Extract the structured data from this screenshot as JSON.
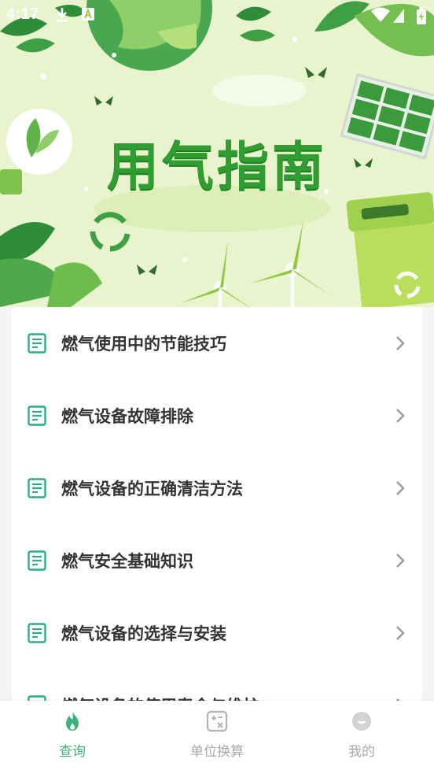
{
  "status_bar": {
    "time": "4:17"
  },
  "hero": {
    "title": "用气指南"
  },
  "guide_list": {
    "items": [
      {
        "label": "燃气使用中的节能技巧",
        "icon": "document-icon"
      },
      {
        "label": "燃气设备故障排除",
        "icon": "document-icon"
      },
      {
        "label": "燃气设备的正确清洁方法",
        "icon": "document-icon"
      },
      {
        "label": "燃气安全基础知识",
        "icon": "document-icon"
      },
      {
        "label": "燃气设备的选择与安装",
        "icon": "document-icon"
      },
      {
        "label": "燃气设备的使用寿命与维护",
        "icon": "document-icon"
      }
    ]
  },
  "bottom_nav": {
    "tabs": [
      {
        "label": "查询",
        "icon": "flame-icon",
        "active": true
      },
      {
        "label": "单位换算",
        "icon": "calculator-icon",
        "active": false
      },
      {
        "label": "我的",
        "icon": "profile-icon",
        "active": false
      }
    ]
  },
  "colors": {
    "accent": "#3bb37a",
    "hero_title": "#2f9d2f",
    "hero_background": "#e9f4cf",
    "inactive": "#a9a9a9"
  }
}
